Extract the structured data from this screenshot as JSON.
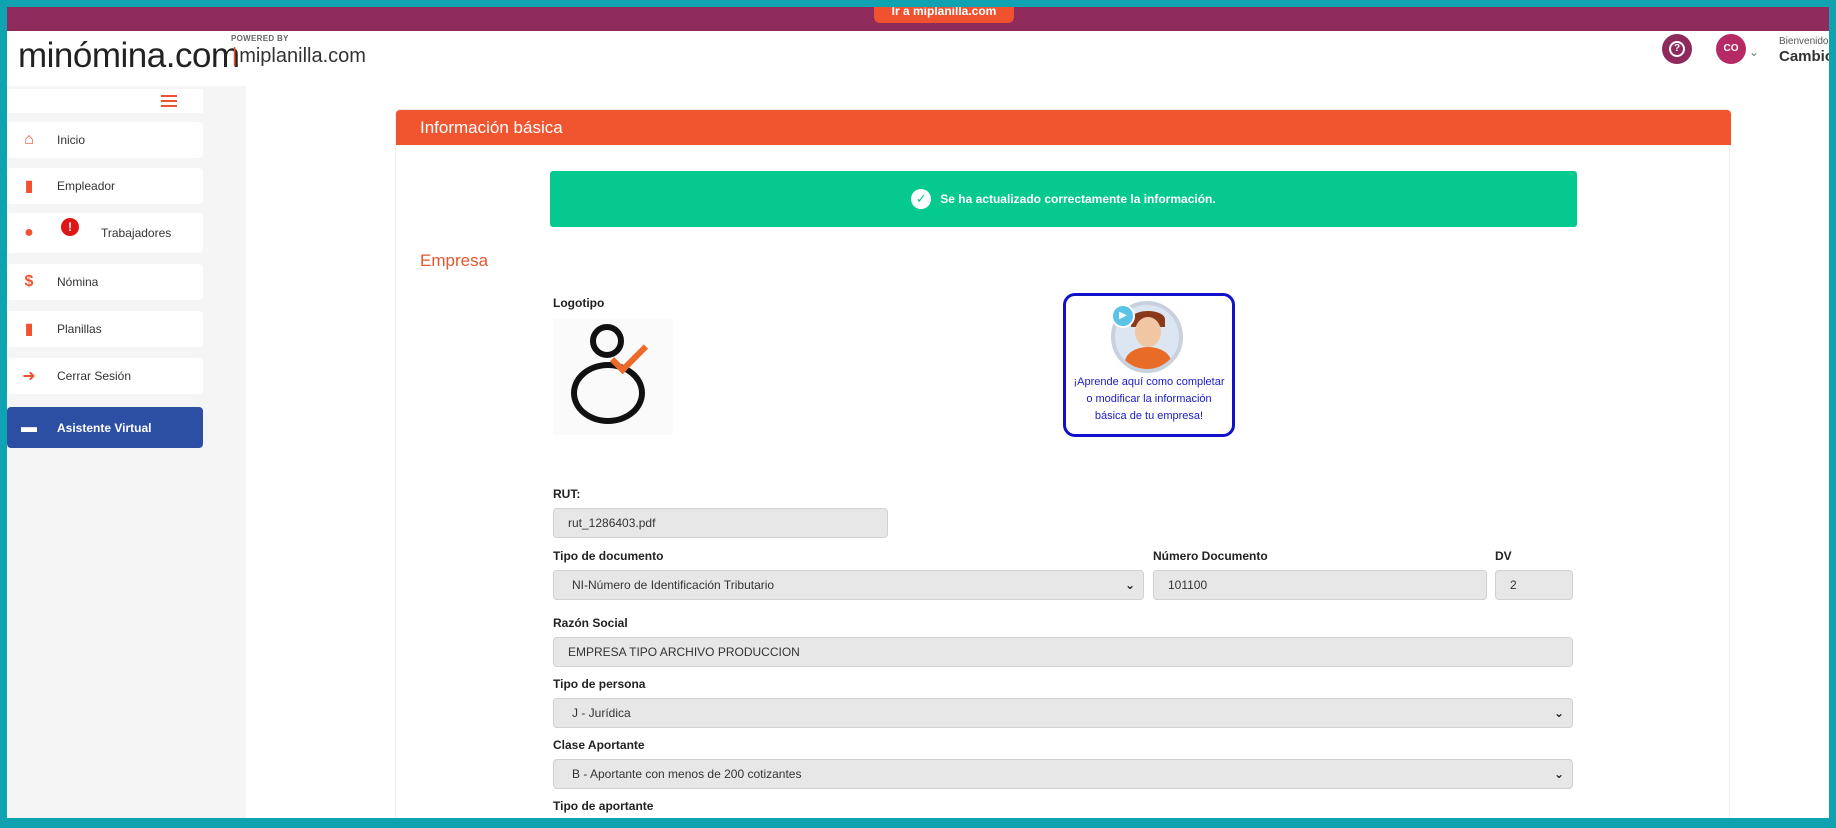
{
  "topbar": {
    "tab_label": "Ir a miplanilla.com"
  },
  "header": {
    "brand": "minómina.com",
    "powered_by": "POWERED BY",
    "partner": "miplanilla.com",
    "avatar_initials": "CO",
    "welcome": "Bienvenido",
    "user_name": "Cambio"
  },
  "sidebar": {
    "items": [
      {
        "label": "Inicio",
        "icon": "home-icon"
      },
      {
        "label": "Empleador",
        "icon": "badge-icon"
      },
      {
        "label": "Trabajadores",
        "icon": "users-icon",
        "alert": "!"
      },
      {
        "label": "Nómina",
        "icon": "dollar-icon"
      },
      {
        "label": "Planillas",
        "icon": "badge-icon"
      },
      {
        "label": "Cerrar Sesión",
        "icon": "logout-icon"
      },
      {
        "label": "Asistente Virtual",
        "icon": "chat-icon",
        "active": true
      }
    ]
  },
  "main": {
    "card_title": "Información básica",
    "success_message": "Se ha actualizado correctamente la información.",
    "section_title": "Empresa",
    "logo_label": "Logotipo",
    "tutorial_text": "¡Aprende aquí como completar o modificar la información básica de tu empresa!",
    "fields": {
      "rut": {
        "label": "RUT:",
        "value": "rut_1286403.pdf"
      },
      "tipo_documento": {
        "label": "Tipo de documento",
        "value": "NI-Número de Identificación Tributario"
      },
      "numero_documento": {
        "label": "Número Documento",
        "value": "101100"
      },
      "dv": {
        "label": "DV",
        "value": "2"
      },
      "razon_social": {
        "label": "Razón Social",
        "value": "EMPRESA TIPO ARCHIVO PRODUCCION"
      },
      "tipo_persona": {
        "label": "Tipo de persona",
        "value": "J - Jurídica"
      },
      "clase_aportante": {
        "label": "Clase Aportante",
        "value": "B - Aportante con menos de 200 cotizantes"
      },
      "tipo_aportante": {
        "label": "Tipo de aportante"
      }
    }
  },
  "colors": {
    "brand_purple": "#8e2a5c",
    "accent_orange": "#f0522f",
    "success_green": "#06c98f",
    "active_blue": "#2d4fa3",
    "frame_teal": "#0fa3b1"
  }
}
